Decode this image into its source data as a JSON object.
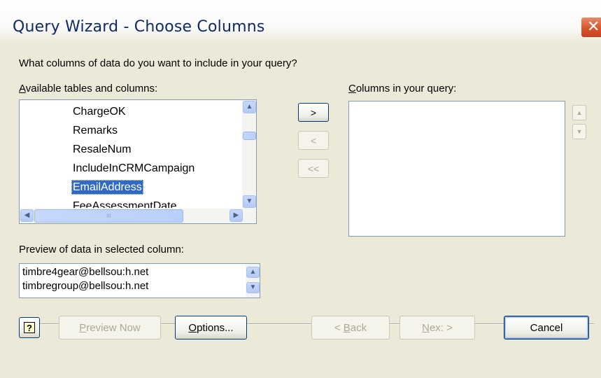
{
  "window": {
    "title": "Query Wizard - Choose Columns",
    "close_glyph": "✕"
  },
  "prompt": "What columns of data do you want to include in your query?",
  "available": {
    "label_accel": "A",
    "label_rest": "vailable tables and columns:",
    "items": [
      "ChargeOK",
      "Remarks",
      "ResaleNum",
      "IncludeInCRMCampaign",
      "EmailAddress",
      "FeeAssessmentDate"
    ],
    "selected": "EmailAddress",
    "hscroll_grip": "III"
  },
  "query_columns": {
    "label_accel": "C",
    "label_rest": "olumns in your query:",
    "items": []
  },
  "move_buttons": {
    "add": ">",
    "remove": "<",
    "remove_all": "<<"
  },
  "preview": {
    "label": "Preview of data in selected column:",
    "items": [
      "timbre4gear@bellsou:h.net",
      "timbregroup@bellsou:h.net"
    ]
  },
  "footer": {
    "preview_now_accel": "P",
    "preview_now_rest": "review Now",
    "options_accel": "O",
    "options_rest": "ptions...",
    "back_prefix": "< ",
    "back_accel": "B",
    "back_rest": "ack",
    "next_accel": "N",
    "next_rest": "ex: >",
    "cancel": "Cancel"
  },
  "icons": {
    "help": "help-icon",
    "close": "close-icon",
    "scroll_up": "scroll-up-icon",
    "scroll_down": "scroll-down-icon",
    "scroll_left": "scroll-left-icon",
    "scroll_right": "scroll-right-icon"
  },
  "colors": {
    "selection": "#316ac5",
    "title_text": "#10296a",
    "dialog_bg": "#ece9d8",
    "close_button": "#d9532d"
  }
}
